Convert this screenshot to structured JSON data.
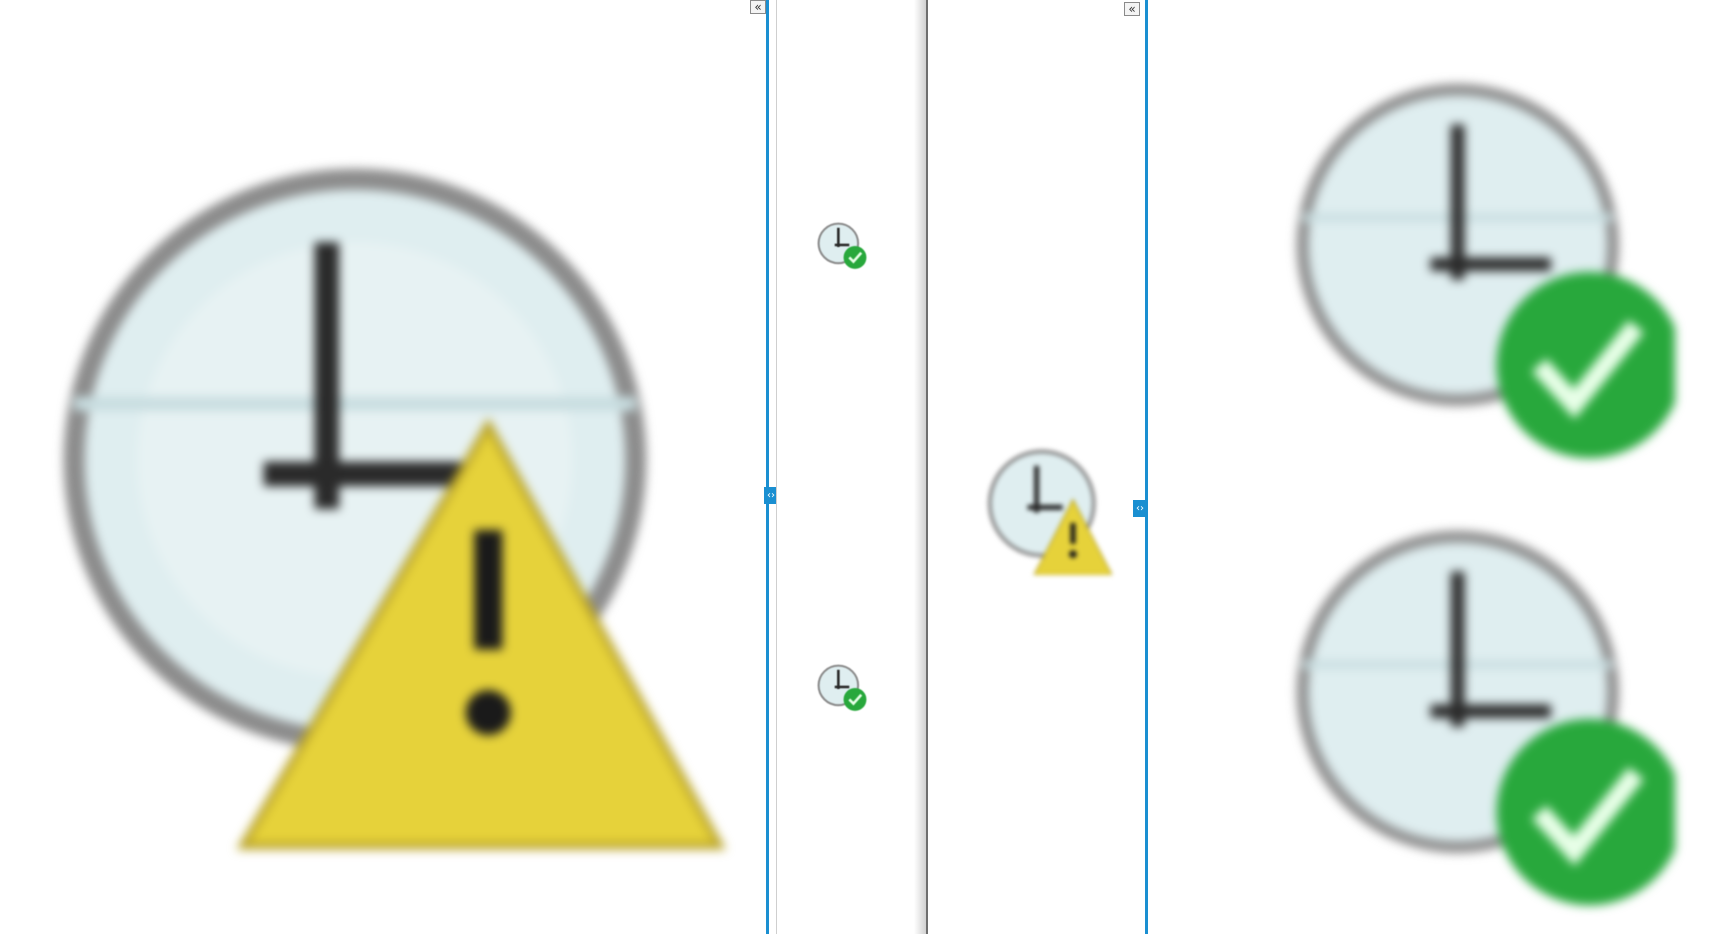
{
  "colors": {
    "accent": "#1a8fd1",
    "clock_face": "#dfeef0",
    "clock_rim": "#8c8c8c",
    "hand": "#2a2a2a",
    "warning_fill": "#e6d23a",
    "check_fill": "#28a83c"
  },
  "controls": {
    "collapse_glyph": "«",
    "split_glyph": "‹›"
  },
  "icons": {
    "left_panel": "clock-warning-icon",
    "middle_top": "clock-check-icon",
    "middle_bottom": "clock-check-icon",
    "right_narrow": "clock-warning-icon",
    "far_right_top": "clock-check-icon",
    "far_right_bottom": "clock-check-icon"
  }
}
